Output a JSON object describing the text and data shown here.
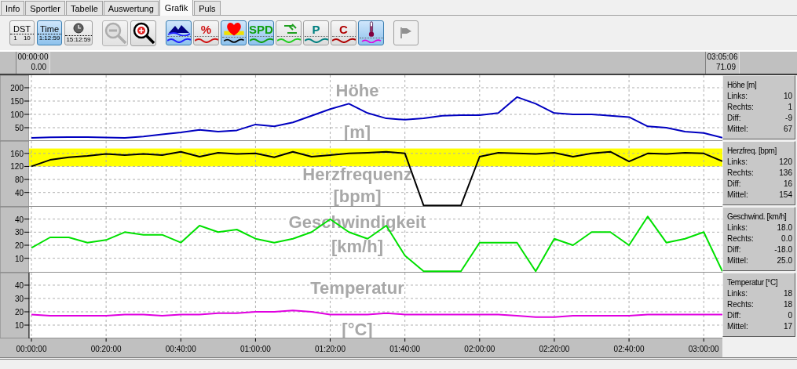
{
  "tabs": [
    {
      "label": "Info",
      "selected": false
    },
    {
      "label": "Sportler",
      "selected": false
    },
    {
      "label": "Tabelle",
      "selected": false
    },
    {
      "label": "Auswertung",
      "selected": false
    },
    {
      "label": "Grafik",
      "selected": true
    },
    {
      "label": "Puls",
      "selected": false
    }
  ],
  "toolbar": {
    "display_buttons": [
      {
        "kind": "dst",
        "label": "DST",
        "scale": [
          "1",
          "10"
        ],
        "selected": false
      },
      {
        "kind": "time",
        "label": "Time",
        "value": "1:12:59",
        "selected": true
      },
      {
        "kind": "clock",
        "value": "15:12:59",
        "selected": false
      }
    ],
    "zoom_buttons": [
      {
        "kind": "zoom_out",
        "disabled": true
      },
      {
        "kind": "zoom_in",
        "disabled": false
      }
    ],
    "channel_buttons": [
      {
        "kind": "altitude",
        "selected": true
      },
      {
        "kind": "text",
        "label": "%",
        "color": "#d01010",
        "selected": false
      },
      {
        "kind": "heart",
        "selected": true
      },
      {
        "kind": "text",
        "label": "SPD",
        "color": "#10a010",
        "selected": true
      },
      {
        "kind": "cadence",
        "selected": false
      },
      {
        "kind": "text",
        "label": "P",
        "color": "#008080",
        "selected": false
      },
      {
        "kind": "text",
        "label": "C",
        "color": "#b00000",
        "selected": false
      },
      {
        "kind": "thermometer",
        "selected": true
      }
    ],
    "marker_button": {
      "disabled": true
    }
  },
  "time_ruler": {
    "left": {
      "time": "00:00:00",
      "distance": "0.00"
    },
    "right": {
      "time": "03:05:06",
      "distance": "71.09"
    }
  },
  "panels": [
    {
      "chart_data": {
        "type": "line",
        "title": "Höhe",
        "ylabel": "[m]",
        "x": [
          0,
          5,
          10,
          15,
          20,
          25,
          30,
          35,
          40,
          45,
          50,
          55,
          60,
          65,
          70,
          75,
          80,
          85,
          90,
          95,
          100,
          105,
          110,
          115,
          120,
          125,
          130,
          135,
          140,
          145,
          150,
          155,
          160,
          165,
          170,
          175,
          180,
          185
        ],
        "xlim": [
          0,
          185
        ],
        "ylim": [
          0,
          247
        ],
        "grid": true,
        "yticks": [
          {
            "value": 50,
            "label": "50"
          },
          {
            "value": 100,
            "label": "100"
          },
          {
            "value": 150,
            "label": "150"
          },
          {
            "value": 200,
            "label": "200"
          }
        ],
        "series": [
          {
            "color": "#0000c0",
            "values": [
              12,
              14,
              15,
              15,
              13,
              12,
              17,
              25,
              32,
              42,
              35,
              40,
              62,
              55,
              70,
              95,
              120,
              140,
              105,
              85,
              80,
              85,
              95,
              97,
              97,
              105,
              165,
              140,
              105,
              100,
              100,
              95,
              90,
              55,
              50,
              35,
              30,
              12
            ]
          }
        ]
      },
      "stats": {
        "title": "Höhe [m]",
        "rows": [
          {
            "label": "Links:",
            "value": "10"
          },
          {
            "label": "Rechts:",
            "value": "1"
          },
          {
            "label": "Diff:",
            "value": "-9"
          },
          {
            "label": "Mittel:",
            "value": "67"
          }
        ]
      }
    },
    {
      "chart_data": {
        "type": "line",
        "title": "Herzfrequenz",
        "ylabel": "[bpm]",
        "x": [
          0,
          5,
          10,
          15,
          20,
          25,
          30,
          35,
          40,
          45,
          50,
          55,
          60,
          65,
          70,
          75,
          80,
          85,
          90,
          95,
          100,
          105,
          110,
          115,
          120,
          125,
          130,
          135,
          140,
          145,
          150,
          155,
          160,
          165,
          170,
          175,
          180,
          185
        ],
        "xlim": [
          0,
          185
        ],
        "ylim": [
          -4,
          198
        ],
        "grid": true,
        "yticks": [
          {
            "value": 40,
            "label": "40"
          },
          {
            "value": 80,
            "label": "80"
          },
          {
            "value": 120,
            "label": "120"
          },
          {
            "value": 160,
            "label": "160"
          }
        ],
        "series": [
          {
            "color": "#000000",
            "values": [
              120,
              140,
              148,
              152,
              158,
              155,
              158,
              155,
              165,
              150,
              162,
              158,
              160,
              148,
              165,
              150,
              155,
              160,
              162,
              165,
              160,
              0,
              0,
              0,
              150,
              162,
              160,
              158,
              162,
              150,
              160,
              165,
              135,
              160,
              158,
              162,
              160,
              136
            ]
          }
        ],
        "bands": [
          {
            "axis": "y",
            "from": 120,
            "to": 175,
            "color": "#ffff00"
          }
        ]
      },
      "stats": {
        "title": "Herzfreq. [bpm]",
        "rows": [
          {
            "label": "Links:",
            "value": "120"
          },
          {
            "label": "Rechts:",
            "value": "136"
          },
          {
            "label": "Diff:",
            "value": "16"
          },
          {
            "label": "Mittel:",
            "value": "154"
          }
        ]
      }
    },
    {
      "chart_data": {
        "type": "line",
        "title": "Geschwindigkeit",
        "ylabel": "[km/h]",
        "x": [
          0,
          5,
          10,
          15,
          20,
          25,
          30,
          35,
          40,
          45,
          50,
          55,
          60,
          65,
          70,
          75,
          80,
          85,
          90,
          95,
          100,
          105,
          110,
          115,
          120,
          125,
          130,
          135,
          140,
          145,
          150,
          155,
          160,
          165,
          170,
          175,
          180,
          185
        ],
        "xlim": [
          0,
          185
        ],
        "ylim": [
          -1,
          49.4
        ],
        "grid": true,
        "yticks": [
          {
            "value": 10,
            "label": "10"
          },
          {
            "value": 20,
            "label": "20"
          },
          {
            "value": 30,
            "label": "30"
          },
          {
            "value": 40,
            "label": "40"
          }
        ],
        "series": [
          {
            "color": "#00e000",
            "values": [
              18,
              26,
              26,
              22,
              24,
              30,
              28,
              28,
              22,
              35,
              30,
              32,
              25,
              22,
              25,
              30,
              40,
              30,
              25,
              35,
              12,
              0,
              0,
              0,
              22,
              22,
              22,
              0,
              25,
              20,
              30,
              30,
              20,
              42,
              22,
              25,
              30,
              0
            ]
          }
        ]
      },
      "stats": {
        "title": "Geschwind. [km/h]",
        "rows": [
          {
            "label": "Links:",
            "value": "18.0"
          },
          {
            "label": "Rechts:",
            "value": "0.0"
          },
          {
            "label": "Diff:",
            "value": "-18.0"
          },
          {
            "label": "Mittel:",
            "value": "25.0"
          }
        ]
      }
    },
    {
      "chart_data": {
        "type": "line",
        "title": "Temperatur",
        "ylabel": "[°C]",
        "x": [
          0,
          5,
          10,
          15,
          20,
          25,
          30,
          35,
          40,
          45,
          50,
          55,
          60,
          65,
          70,
          75,
          80,
          85,
          90,
          95,
          100,
          105,
          110,
          115,
          120,
          125,
          130,
          135,
          140,
          145,
          150,
          155,
          160,
          165,
          170,
          175,
          180,
          185
        ],
        "xlim": [
          0,
          185
        ],
        "ylim": [
          0,
          49.4
        ],
        "grid": true,
        "yticks": [
          {
            "value": 10,
            "label": "10"
          },
          {
            "value": 20,
            "label": "20"
          },
          {
            "value": 30,
            "label": "30"
          },
          {
            "value": 40,
            "label": "40"
          }
        ],
        "xticks": [
          {
            "value": 0,
            "label": "00:00:00"
          },
          {
            "value": 20,
            "label": "00:20:00"
          },
          {
            "value": 40,
            "label": "00:40:00"
          },
          {
            "value": 60,
            "label": "01:00:00"
          },
          {
            "value": 80,
            "label": "01:20:00"
          },
          {
            "value": 100,
            "label": "01:40:00"
          },
          {
            "value": 120,
            "label": "02:00:00"
          },
          {
            "value": 140,
            "label": "02:20:00"
          },
          {
            "value": 160,
            "label": "02:40:00"
          },
          {
            "value": 180,
            "label": "03:00:00"
          }
        ],
        "series": [
          {
            "color": "#e000e0",
            "values": [
              18,
              17,
              17,
              17,
              17,
              18,
              18,
              17,
              18,
              18,
              19,
              19,
              20,
              20,
              21,
              20,
              18,
              18,
              18,
              19,
              18,
              18,
              18,
              18,
              18,
              18,
              17,
              16,
              16,
              17,
              17,
              17,
              17,
              18,
              18,
              18,
              18,
              18
            ]
          }
        ]
      },
      "stats": {
        "title": "Temperatur [°C]",
        "rows": [
          {
            "label": "Links:",
            "value": "18"
          },
          {
            "label": "Rechts:",
            "value": "18"
          },
          {
            "label": "Diff:",
            "value": "0"
          },
          {
            "label": "Mittel:",
            "value": "17"
          }
        ]
      }
    }
  ]
}
